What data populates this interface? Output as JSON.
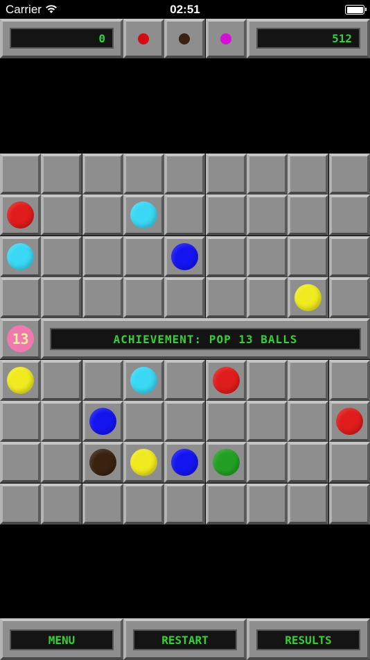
{
  "status_bar": {
    "carrier": "Carrier",
    "time": "02:51"
  },
  "header": {
    "score": "0",
    "best_score": "512",
    "next_balls": [
      {
        "color": "#d40a14"
      },
      {
        "color": "#3a2210"
      },
      {
        "color": "#d410d4"
      }
    ]
  },
  "board": {
    "columns": 9,
    "rows": 9,
    "balls": [
      {
        "row": 1,
        "col": 0,
        "color": "#e01c1c"
      },
      {
        "row": 1,
        "col": 3,
        "color": "#3ad8f4"
      },
      {
        "row": 2,
        "col": 0,
        "color": "#3ad8f4"
      },
      {
        "row": 2,
        "col": 4,
        "color": "#1414f0"
      },
      {
        "row": 3,
        "col": 7,
        "color": "#f0ea20"
      },
      {
        "row": 5,
        "col": 0,
        "color": "#f0ea20"
      },
      {
        "row": 5,
        "col": 3,
        "color": "#3ad8f4"
      },
      {
        "row": 5,
        "col": 5,
        "color": "#e01c1c"
      },
      {
        "row": 6,
        "col": 2,
        "color": "#1414f0"
      },
      {
        "row": 6,
        "col": 8,
        "color": "#e01c1c"
      },
      {
        "row": 7,
        "col": 2,
        "color": "#3a2210"
      },
      {
        "row": 7,
        "col": 3,
        "color": "#f0ea20"
      },
      {
        "row": 7,
        "col": 4,
        "color": "#1414f0"
      },
      {
        "row": 7,
        "col": 5,
        "color": "#23a023"
      }
    ],
    "achievement": {
      "row": 4,
      "badge_count": "13",
      "badge_color": "#f07ab0",
      "text": "ACHIEVEMENT: POP 13 BALLS"
    }
  },
  "footer": {
    "menu_label": "MENU",
    "restart_label": "RESTART",
    "results_label": "RESULTS"
  }
}
